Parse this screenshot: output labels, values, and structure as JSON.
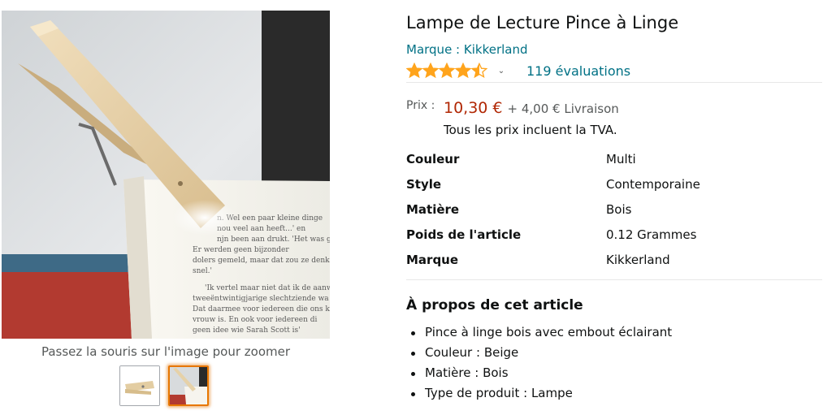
{
  "product": {
    "title": "Lampe de Lecture Pince à Linge",
    "brand_link": "Marque : Kikkerland",
    "rating": {
      "stars": 4.5,
      "stars_max": 5,
      "count_label": "119 évaluations"
    }
  },
  "price": {
    "label": "Prix :",
    "value": "10,30 €",
    "delivery": "+ 4,00 € Livraison",
    "vat_note": "Tous les prix incluent la TVA."
  },
  "specs": [
    {
      "key": "Couleur",
      "value": "Multi"
    },
    {
      "key": "Style",
      "value": "Contemporaine"
    },
    {
      "key": "Matière",
      "value": "Bois"
    },
    {
      "key": "Poids de l'article",
      "value": "0.12 Grammes"
    },
    {
      "key": "Marque",
      "value": "Kikkerland"
    }
  ],
  "about": {
    "heading": "À propos de cet article",
    "bullets": [
      "Pince à linge bois avec embout éclairant",
      "Couleur : Beige",
      "Matière : Bois",
      "Type de produit : Lampe"
    ]
  },
  "gallery": {
    "zoom_hint": "Passez la souris sur l'image pour zoomer",
    "thumbnails": [
      {
        "name": "clothespin-lamp-product-shot",
        "selected": false
      },
      {
        "name": "clothespin-lamp-on-book",
        "selected": true
      }
    ]
  },
  "colors": {
    "link": "#007185",
    "price": "#B12704",
    "star": "#FFA41C",
    "thumb_selected": "#E77600"
  },
  "icons": {
    "rating_dropdown": "chevron-down-icon",
    "star": "star-icon"
  }
}
